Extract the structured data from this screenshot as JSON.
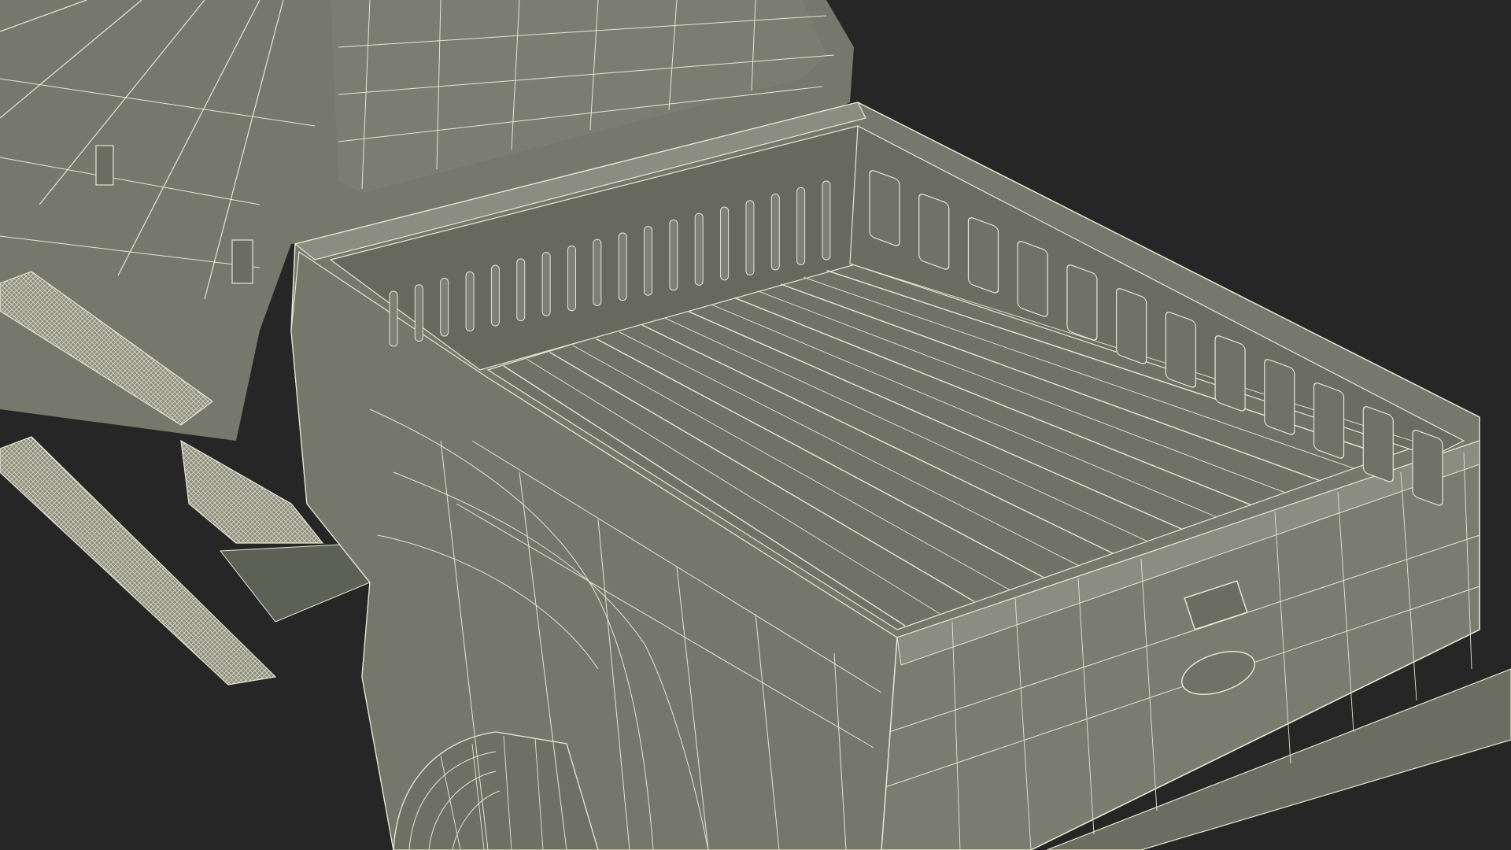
{
  "scene": {
    "subject": "pickup-truck-wireframe",
    "colors": {
      "background": "#262626",
      "surface": "#75786a",
      "surface_dark": "#5d6055",
      "surface_light": "#8a8d7f",
      "wire": "#e6e6d2",
      "step_mesh": "#b8b8a6"
    }
  }
}
